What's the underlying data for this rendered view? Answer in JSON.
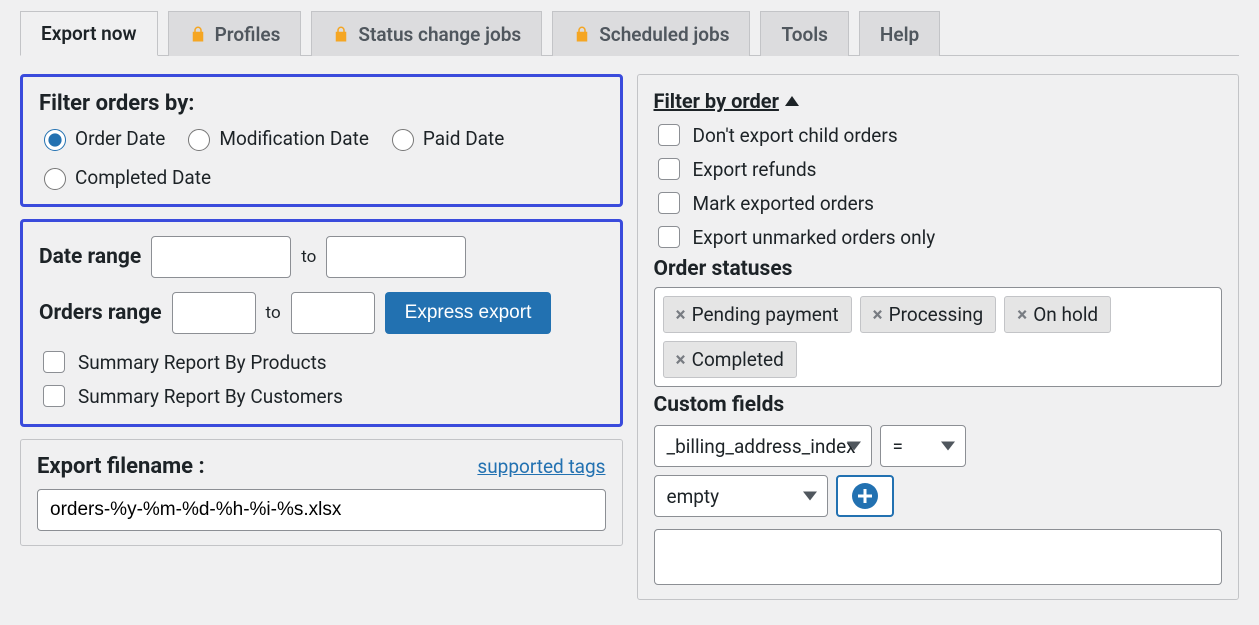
{
  "tabs": {
    "export_now": "Export now",
    "profiles": "Profiles",
    "status_change": "Status change jobs",
    "scheduled": "Scheduled jobs",
    "tools": "Tools",
    "help": "Help"
  },
  "filter_orders": {
    "title": "Filter orders by:",
    "options": {
      "order_date": "Order Date",
      "modification_date": "Modification Date",
      "paid_date": "Paid Date",
      "completed_date": "Completed Date"
    },
    "selected": "order_date"
  },
  "range": {
    "date_label": "Date range",
    "to": "to",
    "orders_label": "Orders range",
    "express_export": "Express export",
    "summary_products": "Summary Report By Products",
    "summary_customers": "Summary Report By Customers",
    "date_from": "",
    "date_to": "",
    "orders_from": "",
    "orders_to": ""
  },
  "filename": {
    "label": "Export filename :",
    "supported_tags": "supported tags",
    "value": "orders-%y-%m-%d-%h-%i-%s.xlsx"
  },
  "right": {
    "filter_by_order": "Filter by order",
    "checks": {
      "no_child": "Don't export child orders",
      "refunds": "Export refunds",
      "mark_exported": "Mark exported orders",
      "unmarked_only": "Export unmarked orders only"
    },
    "order_statuses_label": "Order statuses",
    "statuses": [
      "Pending payment",
      "Processing",
      "On hold",
      "Completed"
    ],
    "custom_fields_label": "Custom fields",
    "cf_field": "_billing_address_index",
    "cf_op": "=",
    "cf_value": "empty"
  }
}
